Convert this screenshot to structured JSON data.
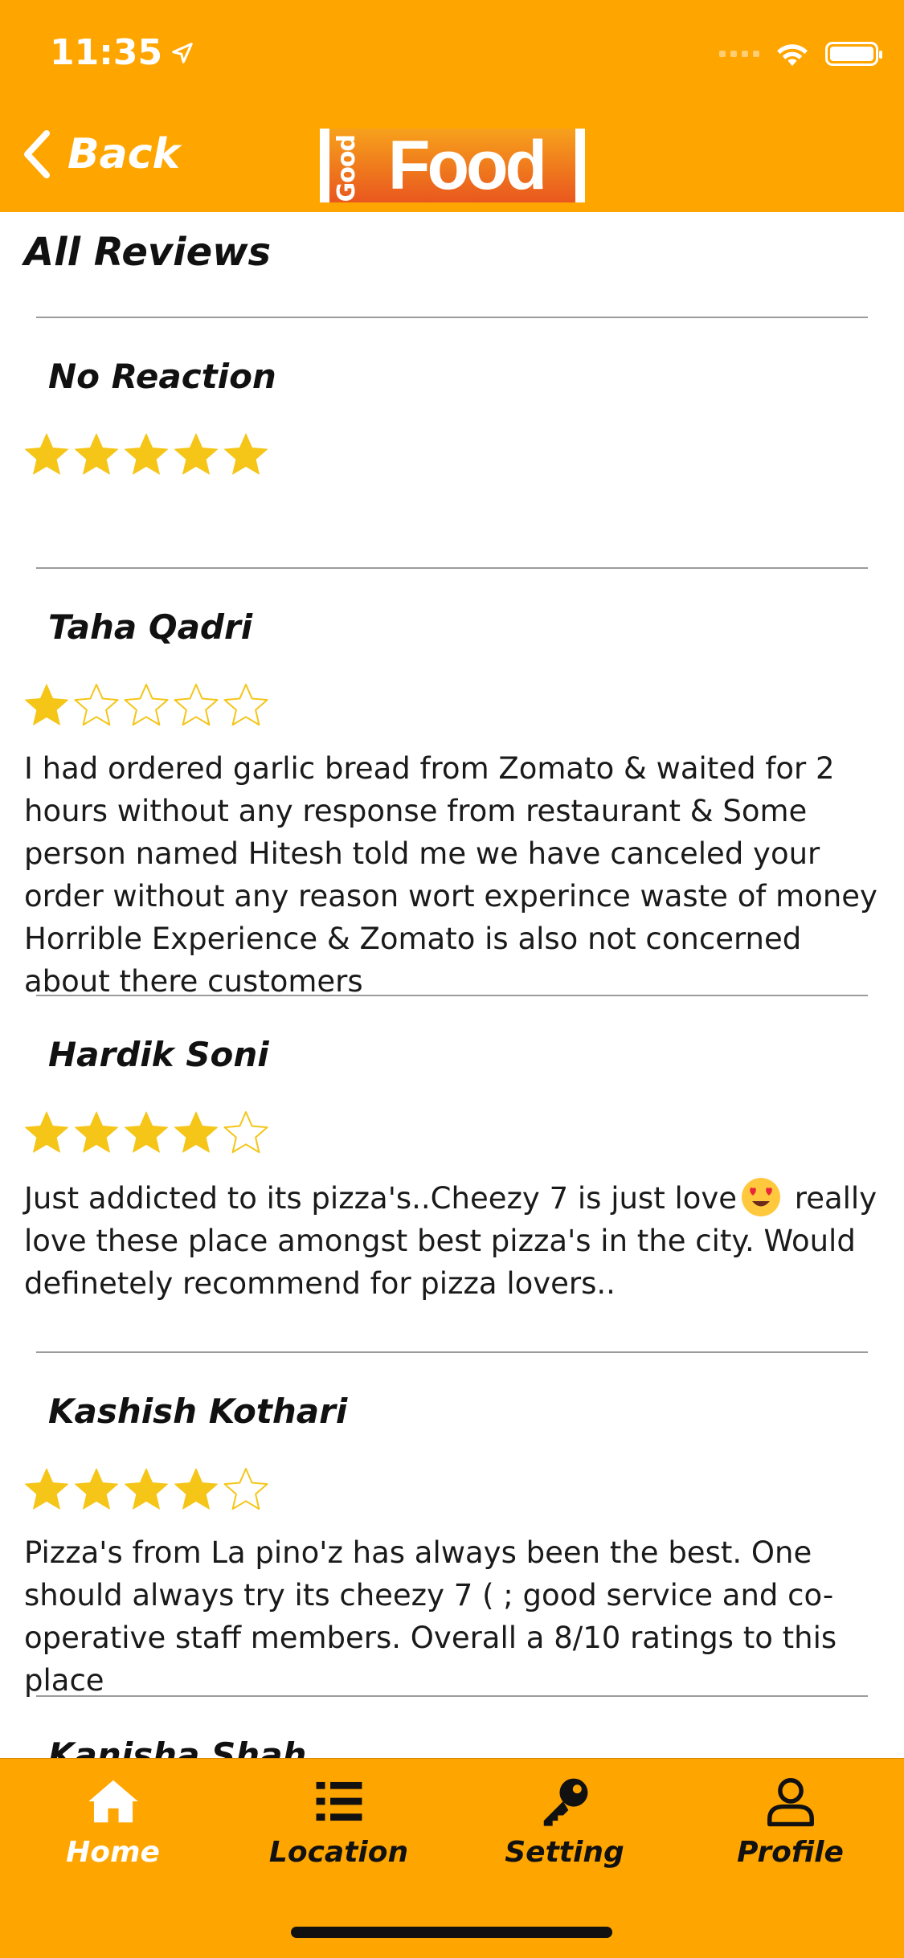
{
  "status_bar": {
    "time": "11:35"
  },
  "header": {
    "back_label": "Back",
    "logo": {
      "good": "Good",
      "food": "Food"
    }
  },
  "page": {
    "title": "All Reviews"
  },
  "reviews": [
    {
      "name": "No Reaction",
      "rating": 5,
      "text": ""
    },
    {
      "name": "Taha Qadri",
      "rating": 1,
      "text": "I had ordered garlic bread from Zomato & waited for 2 hours without any response from restaurant & Some person named Hitesh told me we have canceled your order without any reason wort experince waste of money Horrible Experience & Zomato is also not concerned about there customers"
    },
    {
      "name": "Hardik Soni",
      "rating": 4,
      "text_before_emoji": "Just addicted to its pizza's..Cheezy 7 is just love",
      "emoji": "heart-eyes-emoji",
      "text_after_emoji": " really love these place amongst best pizza's in the city. Would definetely recommend for pizza lovers.."
    },
    {
      "name": "Kashish Kothari",
      "rating": 4,
      "text": "Pizza's from La pino'z has always been the best. One should always try its cheezy 7 ( ; good service and co-operative staff members. Overall a 8/10 ratings to this place"
    },
    {
      "name": "Kanisha Shah",
      "rating": null,
      "text": ""
    }
  ],
  "tabs": [
    {
      "label": "Home",
      "icon": "home-icon",
      "active": true
    },
    {
      "label": "Location",
      "icon": "list-icon",
      "active": false
    },
    {
      "label": "Setting",
      "icon": "key-icon",
      "active": false
    },
    {
      "label": "Profile",
      "icon": "user-icon",
      "active": false
    }
  ],
  "colors": {
    "brand": "#FFA500",
    "star": "#F5C518",
    "active_tab_label": "#FFFFFF"
  }
}
